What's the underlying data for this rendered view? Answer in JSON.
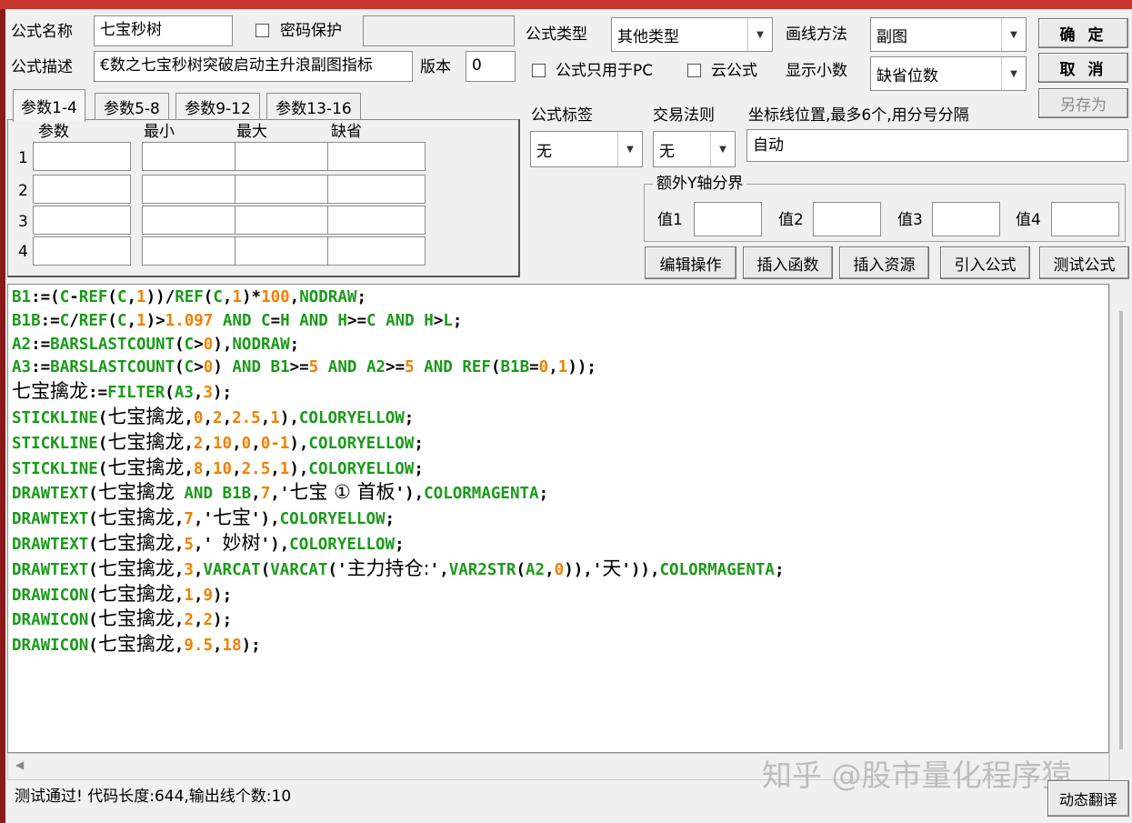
{
  "header": {
    "formula_name_label": "公式名称",
    "formula_name_value": "七宝秒树",
    "password_label": "密码保护",
    "formula_desc_label": "公式描述",
    "formula_desc_value": "€数之七宝秒树突破启动主升浪副图指标",
    "version_label": "版本",
    "version_value": "0",
    "formula_type_label": "公式类型",
    "formula_type_value": "其他类型",
    "draw_method_label": "画线方法",
    "draw_method_value": "副图",
    "pc_only_label": "公式只用于PC",
    "cloud_label": "云公式",
    "decimals_label": "显示小数",
    "decimals_value": "缺省位数"
  },
  "buttons": {
    "ok": "确 定",
    "cancel": "取 消",
    "save_as": "另存为",
    "edit_ops": "编辑操作",
    "insert_func": "插入函数",
    "insert_res": "插入资源",
    "import_formula": "引入公式",
    "test_formula": "测试公式",
    "dyn_translate": "动态翻译"
  },
  "tabs": [
    "参数1-4",
    "参数5-8",
    "参数9-12",
    "参数13-16"
  ],
  "params": {
    "col_param": "参数",
    "col_min": "最小",
    "col_max": "最大",
    "col_default": "缺省",
    "rows": [
      "1",
      "2",
      "3",
      "4"
    ]
  },
  "right_panel": {
    "tag_label": "公式标签",
    "tag_value": "无",
    "trade_rule_label": "交易法则",
    "trade_rule_value": "无",
    "axis_label": "坐标线位置,最多6个,用分号分隔",
    "axis_value": "自动",
    "extra_y_label": "额外Y轴分界",
    "val1_label": "值1",
    "val2_label": "值2",
    "val3_label": "值3",
    "val4_label": "值4"
  },
  "code_lines": [
    [
      [
        "k",
        "B1"
      ],
      [
        "p",
        ":=("
      ],
      [
        "k",
        "C"
      ],
      [
        "p",
        "-"
      ],
      [
        "k",
        "REF"
      ],
      [
        "p",
        "("
      ],
      [
        "k",
        "C"
      ],
      [
        "p",
        ","
      ],
      [
        "n",
        "1"
      ],
      [
        "p",
        "))/"
      ],
      [
        "k",
        "REF"
      ],
      [
        "p",
        "("
      ],
      [
        "k",
        "C"
      ],
      [
        "p",
        ","
      ],
      [
        "n",
        "1"
      ],
      [
        "p",
        ")*"
      ],
      [
        "n",
        "100"
      ],
      [
        "p",
        ","
      ],
      [
        "k",
        "NODRAW"
      ],
      [
        "p",
        ";"
      ]
    ],
    [
      [
        "k",
        "B1B"
      ],
      [
        "p",
        ":="
      ],
      [
        "k",
        "C"
      ],
      [
        "p",
        "/"
      ],
      [
        "k",
        "REF"
      ],
      [
        "p",
        "("
      ],
      [
        "k",
        "C"
      ],
      [
        "p",
        ","
      ],
      [
        "n",
        "1"
      ],
      [
        "p",
        ")>"
      ],
      [
        "n",
        "1.097"
      ],
      [
        "p",
        " "
      ],
      [
        "k",
        "AND"
      ],
      [
        "p",
        " "
      ],
      [
        "k",
        "C"
      ],
      [
        "p",
        "="
      ],
      [
        "k",
        "H"
      ],
      [
        "p",
        " "
      ],
      [
        "k",
        "AND"
      ],
      [
        "p",
        " "
      ],
      [
        "k",
        "H"
      ],
      [
        "p",
        ">="
      ],
      [
        "k",
        "C"
      ],
      [
        "p",
        " "
      ],
      [
        "k",
        "AND"
      ],
      [
        "p",
        " "
      ],
      [
        "k",
        "H"
      ],
      [
        "p",
        ">"
      ],
      [
        "k",
        "L"
      ],
      [
        "p",
        ";"
      ]
    ],
    [
      [
        "k",
        "A2"
      ],
      [
        "p",
        ":="
      ],
      [
        "k",
        "BARSLASTCOUNT"
      ],
      [
        "p",
        "("
      ],
      [
        "k",
        "C"
      ],
      [
        "p",
        ">"
      ],
      [
        "n",
        "0"
      ],
      [
        "p",
        "),"
      ],
      [
        "k",
        "NODRAW"
      ],
      [
        "p",
        ";"
      ]
    ],
    [
      [
        "k",
        "A3"
      ],
      [
        "p",
        ":="
      ],
      [
        "k",
        "BARSLASTCOUNT"
      ],
      [
        "p",
        "("
      ],
      [
        "k",
        "C"
      ],
      [
        "p",
        ">"
      ],
      [
        "n",
        "0"
      ],
      [
        "p",
        ") "
      ],
      [
        "k",
        "AND"
      ],
      [
        "p",
        " "
      ],
      [
        "k",
        "B1"
      ],
      [
        "p",
        ">="
      ],
      [
        "n",
        "5"
      ],
      [
        "p",
        " "
      ],
      [
        "k",
        "AND"
      ],
      [
        "p",
        " "
      ],
      [
        "k",
        "A2"
      ],
      [
        "p",
        ">="
      ],
      [
        "n",
        "5"
      ],
      [
        "p",
        " "
      ],
      [
        "k",
        "AND"
      ],
      [
        "p",
        " "
      ],
      [
        "k",
        "REF"
      ],
      [
        "p",
        "("
      ],
      [
        "k",
        "B1B"
      ],
      [
        "p",
        "="
      ],
      [
        "n",
        "0"
      ],
      [
        "p",
        ","
      ],
      [
        "n",
        "1"
      ],
      [
        "p",
        "));"
      ]
    ],
    [
      [
        "c",
        "七宝擒龙"
      ],
      [
        "p",
        ":="
      ],
      [
        "k",
        "FILTER"
      ],
      [
        "p",
        "("
      ],
      [
        "k",
        "A3"
      ],
      [
        "p",
        ","
      ],
      [
        "n",
        "3"
      ],
      [
        "p",
        ");"
      ]
    ],
    [
      [
        "k",
        "STICKLINE"
      ],
      [
        "p",
        "("
      ],
      [
        "c",
        "七宝擒龙"
      ],
      [
        "p",
        ","
      ],
      [
        "n",
        "0"
      ],
      [
        "p",
        ","
      ],
      [
        "n",
        "2"
      ],
      [
        "p",
        ","
      ],
      [
        "n",
        "2.5"
      ],
      [
        "p",
        ","
      ],
      [
        "n",
        "1"
      ],
      [
        "p",
        "),"
      ],
      [
        "k",
        "COLORYELLOW"
      ],
      [
        "p",
        ";"
      ]
    ],
    [
      [
        "k",
        "STICKLINE"
      ],
      [
        "p",
        "("
      ],
      [
        "c",
        "七宝擒龙"
      ],
      [
        "p",
        ","
      ],
      [
        "n",
        "2"
      ],
      [
        "p",
        ","
      ],
      [
        "n",
        "10"
      ],
      [
        "p",
        ","
      ],
      [
        "n",
        "0"
      ],
      [
        "p",
        ","
      ],
      [
        "n",
        "0-1"
      ],
      [
        "p",
        "),"
      ],
      [
        "k",
        "COLORYELLOW"
      ],
      [
        "p",
        ";"
      ]
    ],
    [
      [
        "k",
        "STICKLINE"
      ],
      [
        "p",
        "("
      ],
      [
        "c",
        "七宝擒龙"
      ],
      [
        "p",
        ","
      ],
      [
        "n",
        "8"
      ],
      [
        "p",
        ","
      ],
      [
        "n",
        "10"
      ],
      [
        "p",
        ","
      ],
      [
        "n",
        "2.5"
      ],
      [
        "p",
        ","
      ],
      [
        "n",
        "1"
      ],
      [
        "p",
        "),"
      ],
      [
        "k",
        "COLORYELLOW"
      ],
      [
        "p",
        ";"
      ]
    ],
    [
      [
        "k",
        "DRAWTEXT"
      ],
      [
        "p",
        "("
      ],
      [
        "c",
        "七宝擒龙"
      ],
      [
        "p",
        " "
      ],
      [
        "k",
        "AND"
      ],
      [
        "p",
        " "
      ],
      [
        "k",
        "B1B"
      ],
      [
        "p",
        ","
      ],
      [
        "n",
        "7"
      ],
      [
        "p",
        ",'"
      ],
      [
        "c",
        "七宝 ① 首板"
      ],
      [
        "p",
        "'),"
      ],
      [
        "k",
        "COLORMAGENTA"
      ],
      [
        "p",
        ";"
      ]
    ],
    [
      [
        "k",
        "DRAWTEXT"
      ],
      [
        "p",
        "("
      ],
      [
        "c",
        "七宝擒龙"
      ],
      [
        "p",
        ","
      ],
      [
        "n",
        "7"
      ],
      [
        "p",
        ",'"
      ],
      [
        "c",
        "七宝"
      ],
      [
        "p",
        "'),"
      ],
      [
        "k",
        "COLORYELLOW"
      ],
      [
        "p",
        ";"
      ]
    ],
    [
      [
        "k",
        "DRAWTEXT"
      ],
      [
        "p",
        "("
      ],
      [
        "c",
        "七宝擒龙"
      ],
      [
        "p",
        ","
      ],
      [
        "n",
        "5"
      ],
      [
        "p",
        ",' "
      ],
      [
        "c",
        "妙树"
      ],
      [
        "p",
        "'),"
      ],
      [
        "k",
        "COLORYELLOW"
      ],
      [
        "p",
        ";"
      ]
    ],
    [
      [
        "k",
        "DRAWTEXT"
      ],
      [
        "p",
        "("
      ],
      [
        "c",
        "七宝擒龙"
      ],
      [
        "p",
        ","
      ],
      [
        "n",
        "3"
      ],
      [
        "p",
        ","
      ],
      [
        "k",
        "VARCAT"
      ],
      [
        "p",
        "("
      ],
      [
        "k",
        "VARCAT"
      ],
      [
        "p",
        "('"
      ],
      [
        "c",
        "主力持仓:"
      ],
      [
        "p",
        "',"
      ],
      [
        "k",
        "VAR2STR"
      ],
      [
        "p",
        "("
      ],
      [
        "k",
        "A2"
      ],
      [
        "p",
        ","
      ],
      [
        "n",
        "0"
      ],
      [
        "p",
        ")),'"
      ],
      [
        "c",
        "天"
      ],
      [
        "p",
        "')),"
      ],
      [
        "k",
        "COLORMAGENTA"
      ],
      [
        "p",
        ";"
      ]
    ],
    [
      [
        "k",
        "DRAWICON"
      ],
      [
        "p",
        "("
      ],
      [
        "c",
        "七宝擒龙"
      ],
      [
        "p",
        ","
      ],
      [
        "n",
        "1"
      ],
      [
        "p",
        ","
      ],
      [
        "n",
        "9"
      ],
      [
        "p",
        ");"
      ]
    ],
    [
      [
        "k",
        "DRAWICON"
      ],
      [
        "p",
        "("
      ],
      [
        "c",
        "七宝擒龙"
      ],
      [
        "p",
        ","
      ],
      [
        "n",
        "2"
      ],
      [
        "p",
        ","
      ],
      [
        "n",
        "2"
      ],
      [
        "p",
        ");"
      ]
    ],
    [
      [
        "k",
        "DRAWICON"
      ],
      [
        "p",
        "("
      ],
      [
        "c",
        "七宝擒龙"
      ],
      [
        "p",
        ","
      ],
      [
        "n",
        "9.5"
      ],
      [
        "p",
        ","
      ],
      [
        "n",
        "18"
      ],
      [
        "p",
        ");"
      ]
    ]
  ],
  "status_text": "测试通过! 代码长度:644,输出线个数:10",
  "watermark": "知乎 @股市量化程序猿",
  "colors": {
    "keyword": "#1a9a1a",
    "number": "#f08000",
    "titlebar": "#c8372d"
  },
  "icons": {
    "dropdown": "chevron-down-icon",
    "scroll_left": "arrow-left-icon"
  }
}
